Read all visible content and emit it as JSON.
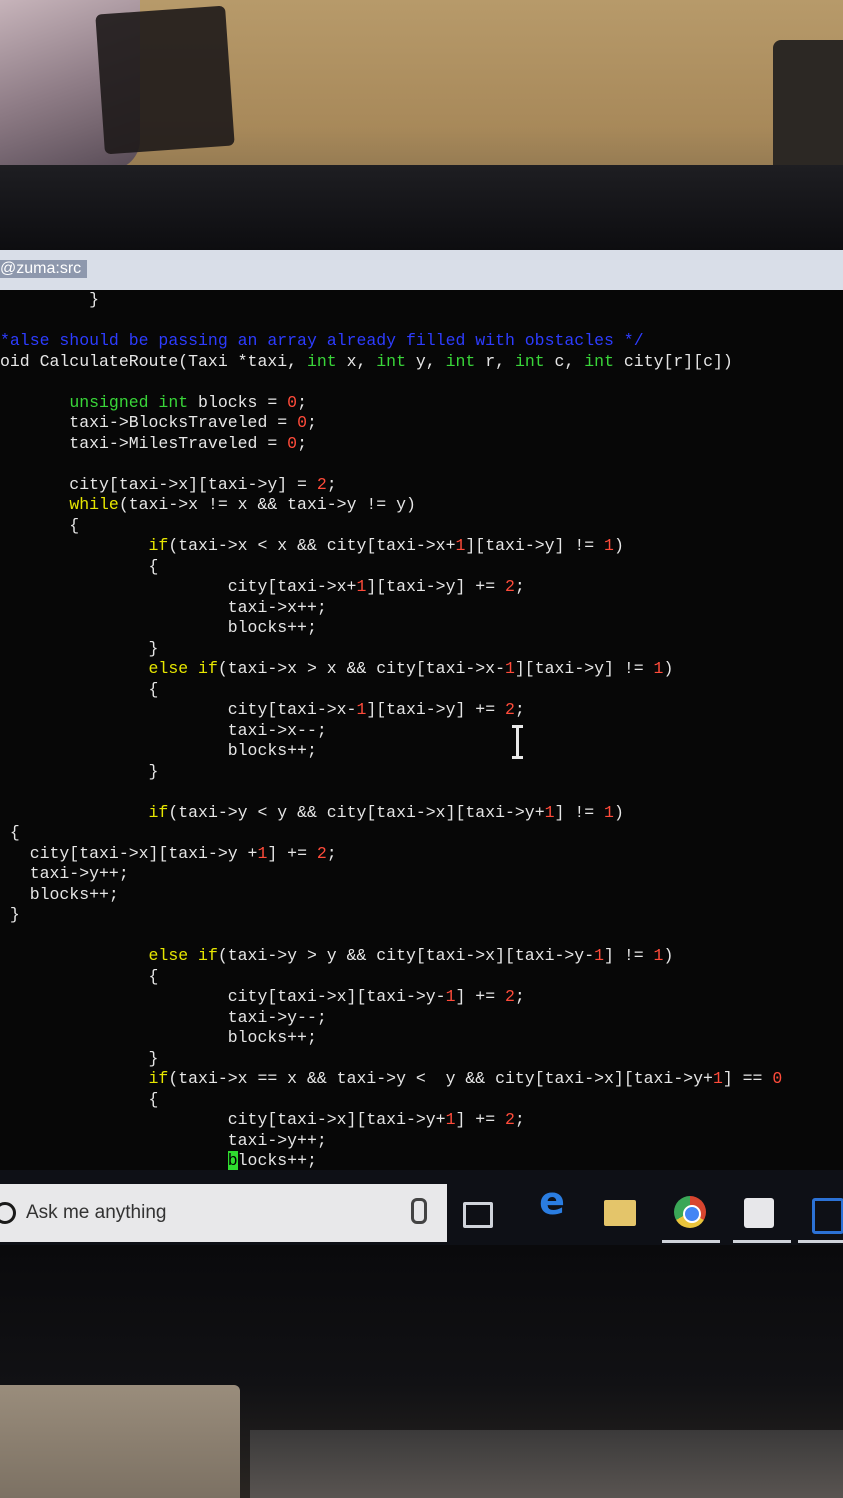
{
  "terminal": {
    "title": "@zuma:src",
    "cursor_char": "b"
  },
  "code_lines": [
    [
      {
        "t": "         }"
      }
    ],
    [
      {
        "t": ""
      }
    ],
    [
      {
        "t": "*alse should be passing an array already filled with obstacles */",
        "c": "cmt"
      }
    ],
    [
      {
        "t": "oid CalculateRoute(Taxi *taxi, "
      },
      {
        "t": "int",
        "c": "ty"
      },
      {
        "t": " x, "
      },
      {
        "t": "int",
        "c": "ty"
      },
      {
        "t": " y, "
      },
      {
        "t": "int",
        "c": "ty"
      },
      {
        "t": " r, "
      },
      {
        "t": "int",
        "c": "ty"
      },
      {
        "t": " c, "
      },
      {
        "t": "int",
        "c": "ty"
      },
      {
        "t": " city[r][c])"
      }
    ],
    [
      {
        "t": ""
      }
    ],
    [
      {
        "t": "       "
      },
      {
        "t": "unsigned int",
        "c": "ty"
      },
      {
        "t": " blocks = "
      },
      {
        "t": "0",
        "c": "num"
      },
      {
        "t": ";"
      }
    ],
    [
      {
        "t": "       taxi->BlocksTraveled = "
      },
      {
        "t": "0",
        "c": "num"
      },
      {
        "t": ";"
      }
    ],
    [
      {
        "t": "       taxi->MilesTraveled = "
      },
      {
        "t": "0",
        "c": "num"
      },
      {
        "t": ";"
      }
    ],
    [
      {
        "t": ""
      }
    ],
    [
      {
        "t": "       city[taxi->x][taxi->y] = "
      },
      {
        "t": "2",
        "c": "num"
      },
      {
        "t": ";"
      }
    ],
    [
      {
        "t": "       "
      },
      {
        "t": "while",
        "c": "kw"
      },
      {
        "t": "(taxi->x != x && taxi->y != y)"
      }
    ],
    [
      {
        "t": "       {"
      }
    ],
    [
      {
        "t": "               "
      },
      {
        "t": "if",
        "c": "kw"
      },
      {
        "t": "(taxi->x < x && city[taxi->x+"
      },
      {
        "t": "1",
        "c": "num"
      },
      {
        "t": "][taxi->y] != "
      },
      {
        "t": "1",
        "c": "num"
      },
      {
        "t": ")"
      }
    ],
    [
      {
        "t": "               {"
      }
    ],
    [
      {
        "t": "                       city[taxi->x+"
      },
      {
        "t": "1",
        "c": "num"
      },
      {
        "t": "][taxi->y] += "
      },
      {
        "t": "2",
        "c": "num"
      },
      {
        "t": ";"
      }
    ],
    [
      {
        "t": "                       taxi->x++;"
      }
    ],
    [
      {
        "t": "                       blocks++;"
      }
    ],
    [
      {
        "t": "               }"
      }
    ],
    [
      {
        "t": "               "
      },
      {
        "t": "else if",
        "c": "kw"
      },
      {
        "t": "(taxi->x > x && city[taxi->x-"
      },
      {
        "t": "1",
        "c": "num"
      },
      {
        "t": "][taxi->y] != "
      },
      {
        "t": "1",
        "c": "num"
      },
      {
        "t": ")"
      }
    ],
    [
      {
        "t": "               {"
      }
    ],
    [
      {
        "t": "                       city[taxi->x-"
      },
      {
        "t": "1",
        "c": "num"
      },
      {
        "t": "][taxi->y] += "
      },
      {
        "t": "2",
        "c": "num"
      },
      {
        "t": ";"
      }
    ],
    [
      {
        "t": "                       taxi->x--;"
      }
    ],
    [
      {
        "t": "                       blocks++;"
      }
    ],
    [
      {
        "t": "               }"
      }
    ],
    [
      {
        "t": ""
      }
    ],
    [
      {
        "t": "               "
      },
      {
        "t": "if",
        "c": "kw"
      },
      {
        "t": "(taxi->y < y && city[taxi->x][taxi->y+"
      },
      {
        "t": "1",
        "c": "num"
      },
      {
        "t": "] != "
      },
      {
        "t": "1",
        "c": "num"
      },
      {
        "t": ")"
      }
    ],
    [
      {
        "t": " {"
      }
    ],
    [
      {
        "t": "   city[taxi->x][taxi->y +"
      },
      {
        "t": "1",
        "c": "num"
      },
      {
        "t": "] += "
      },
      {
        "t": "2",
        "c": "num"
      },
      {
        "t": ";"
      }
    ],
    [
      {
        "t": "   taxi->y++;"
      }
    ],
    [
      {
        "t": "   blocks++;"
      }
    ],
    [
      {
        "t": " }"
      }
    ],
    [
      {
        "t": ""
      }
    ],
    [
      {
        "t": "               "
      },
      {
        "t": "else if",
        "c": "kw"
      },
      {
        "t": "(taxi->y > y && city[taxi->x][taxi->y-"
      },
      {
        "t": "1",
        "c": "num"
      },
      {
        "t": "] != "
      },
      {
        "t": "1",
        "c": "num"
      },
      {
        "t": ")"
      }
    ],
    [
      {
        "t": "               {"
      }
    ],
    [
      {
        "t": "                       city[taxi->x][taxi->y-"
      },
      {
        "t": "1",
        "c": "num"
      },
      {
        "t": "] += "
      },
      {
        "t": "2",
        "c": "num"
      },
      {
        "t": ";"
      }
    ],
    [
      {
        "t": "                       taxi->y--;"
      }
    ],
    [
      {
        "t": "                       blocks++;"
      }
    ],
    [
      {
        "t": "               }"
      }
    ],
    [
      {
        "t": "               "
      },
      {
        "t": "if",
        "c": "kw"
      },
      {
        "t": "(taxi->x == x && taxi->y <  y && city[taxi->x][taxi->y+"
      },
      {
        "t": "1",
        "c": "num"
      },
      {
        "t": "] == "
      },
      {
        "t": "0",
        "c": "num"
      }
    ],
    [
      {
        "t": "               {"
      }
    ],
    [
      {
        "t": "                       city[taxi->x][taxi->y+"
      },
      {
        "t": "1",
        "c": "num"
      },
      {
        "t": "] += "
      },
      {
        "t": "2",
        "c": "num"
      },
      {
        "t": ";"
      }
    ],
    [
      {
        "t": "                       taxi->y++;"
      }
    ],
    [
      {
        "t": "                       "
      },
      {
        "t": "b",
        "c": "cursor"
      },
      {
        "t": "locks++;"
      }
    ]
  ],
  "taskbar": {
    "search_placeholder": "Ask me anything",
    "icons": [
      "search-icon",
      "microphone-icon",
      "task-view-icon",
      "edge-icon",
      "file-explorer-icon",
      "chrome-icon",
      "store-icon",
      "network-app-icon"
    ]
  },
  "colors": {
    "keyword": "#e6e600",
    "type": "#39d639",
    "number": "#ff4b3a",
    "comment": "#2d3cff",
    "cursor": "#2fdc2f",
    "text": "#e6e6e6",
    "background": "#070707"
  }
}
